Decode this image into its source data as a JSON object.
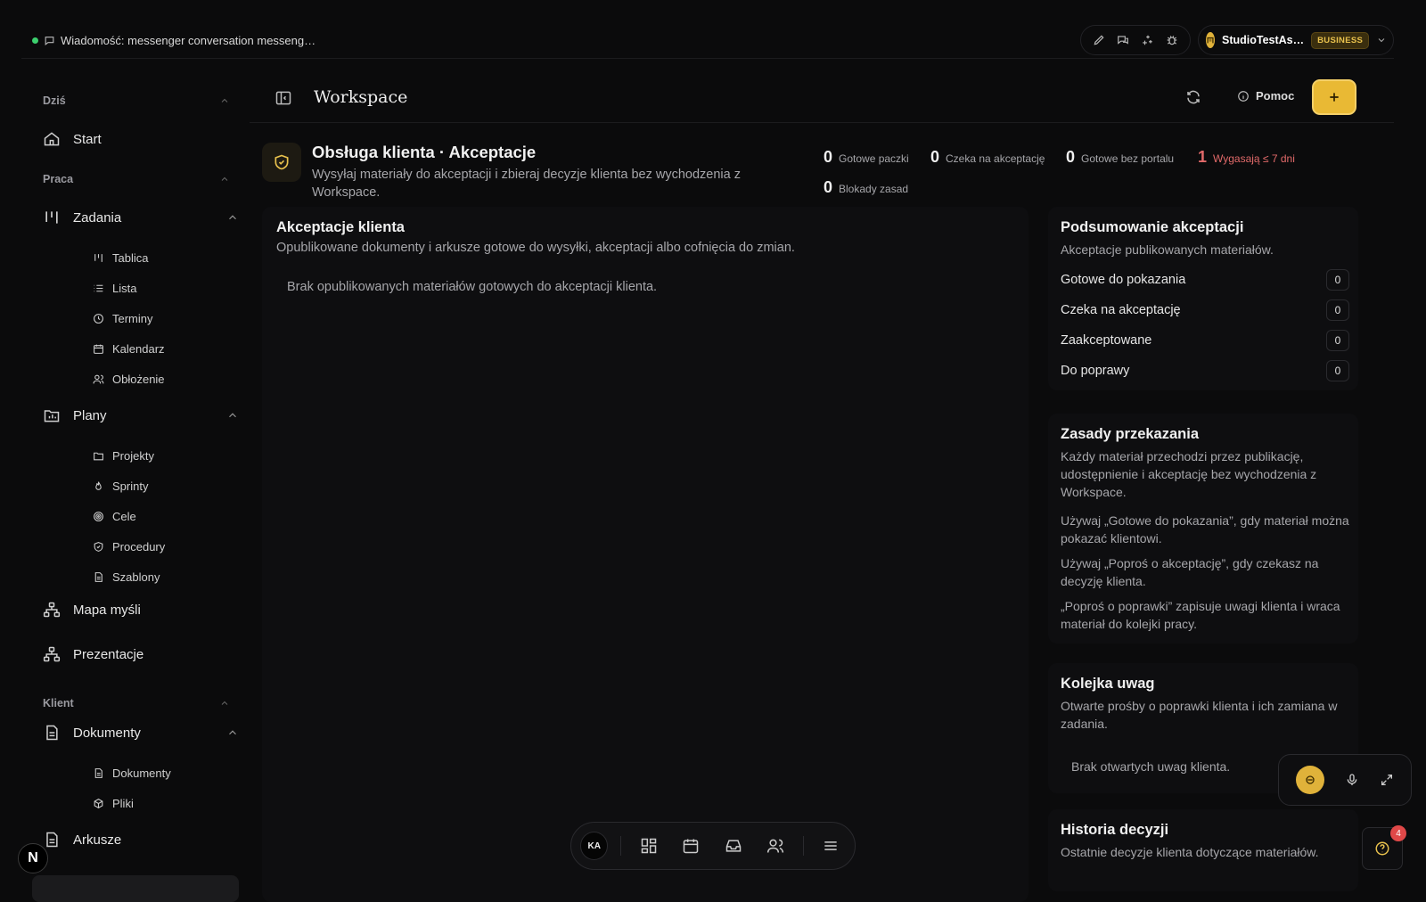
{
  "topbar": {
    "message": "Wiadomość: messenger conversation messeng…",
    "account_name": "StudioTestAs…",
    "account_plan": "BUSINESS"
  },
  "sidebar": {
    "sections": {
      "today": "Dziś",
      "work": "Praca",
      "client": "Klient"
    },
    "start": "Start",
    "tasks": "Zadania",
    "tasks_items": [
      "Tablica",
      "Lista",
      "Terminy",
      "Kalendarz",
      "Obłożenie"
    ],
    "plans": "Plany",
    "plans_items": [
      "Projekty",
      "Sprinty",
      "Cele",
      "Procedury",
      "Szablony"
    ],
    "mindmap": "Mapa myśli",
    "presentations": "Prezentacje",
    "documents": "Dokumenty",
    "documents_items": [
      "Dokumenty",
      "Pliki"
    ],
    "sheets": "Arkusze"
  },
  "header": {
    "title": "Workspace",
    "help": "Pomoc"
  },
  "banner": {
    "title": "Obsługa klienta · Akceptacje",
    "description": "Wysyłaj materiały do akceptacji i zbieraj decyzje klienta bez wychodzenia z Workspace.",
    "stats": [
      {
        "value": "0",
        "label": "Gotowe paczki"
      },
      {
        "value": "0",
        "label": "Czeka na akceptację"
      },
      {
        "value": "0",
        "label": "Gotowe bez portalu"
      },
      {
        "value": "1",
        "label": "Wygasają ≤ 7 dni"
      },
      {
        "value": "0",
        "label": "Blokady zasad"
      }
    ]
  },
  "approvals": {
    "title": "Akceptacje klienta",
    "description": "Opublikowane dokumenty i arkusze gotowe do wysyłki, akceptacji albo cofnięcia do zmian.",
    "empty": "Brak opublikowanych materiałów gotowych do akceptacji klienta."
  },
  "summary": {
    "title": "Podsumowanie akceptacji",
    "description": "Akceptacje publikowanych materiałów.",
    "rows": [
      {
        "label": "Gotowe do pokazania",
        "count": "0"
      },
      {
        "label": "Czeka na akceptację",
        "count": "0"
      },
      {
        "label": "Zaakceptowane",
        "count": "0"
      },
      {
        "label": "Do poprawy",
        "count": "0"
      }
    ]
  },
  "rules": {
    "title": "Zasady przekazania",
    "description": "Każdy materiał przechodzi przez publikację, udostępnienie i akceptację bez wychodzenia z Workspace.",
    "items": [
      "Używaj „Gotowe do pokazania”, gdy materiał można pokazać klientowi.",
      "Używaj „Poproś o akceptację”, gdy czekasz na decyzję klienta.",
      "„Poproś o poprawki” zapisuje uwagi klienta i wraca materiał do kolejki pracy."
    ]
  },
  "queue": {
    "title": "Kolejka uwag",
    "description": "Otwarte prośby o poprawki klienta i ich zamiana w zadania.",
    "empty": "Brak otwartych uwag klienta."
  },
  "history": {
    "title": "Historia decyzji",
    "description": "Ostatnie decyzje klienta dotyczące materiałów."
  },
  "dock": {
    "avatar": "KA"
  },
  "help_badge": "4",
  "colors": {
    "accent": "#e9b934",
    "danger": "#e26a6a",
    "online": "#3ccf6e",
    "bg": "#0b0b0c"
  }
}
